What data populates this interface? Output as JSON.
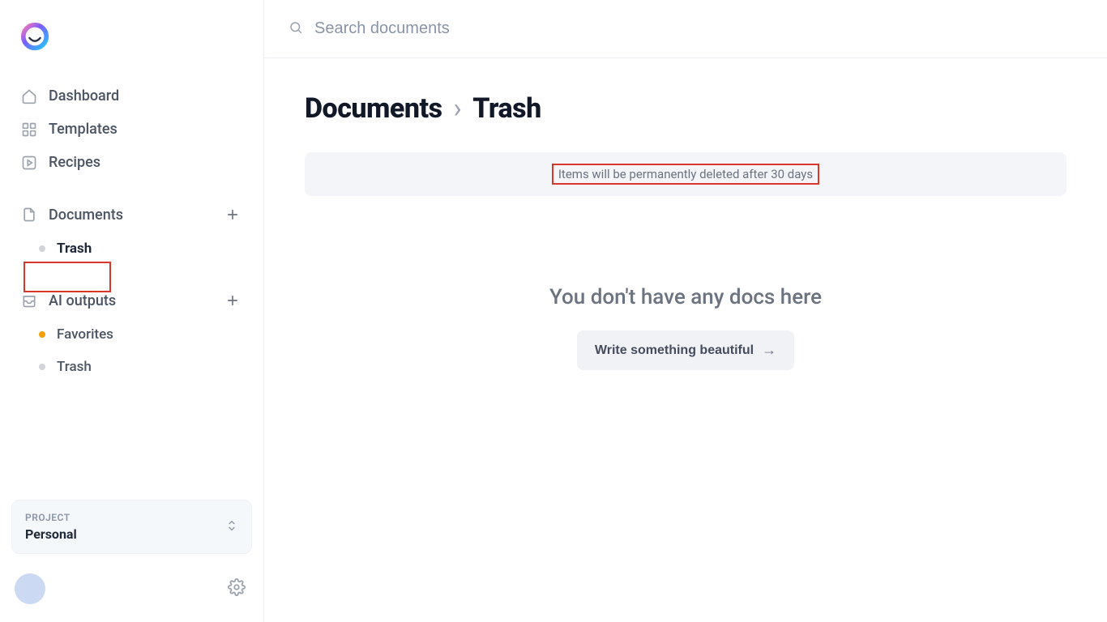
{
  "search": {
    "placeholder": "Search documents"
  },
  "sidebar": {
    "items": [
      {
        "label": "Dashboard"
      },
      {
        "label": "Templates"
      },
      {
        "label": "Recipes"
      },
      {
        "label": "Documents"
      },
      {
        "label": "Trash"
      },
      {
        "label": "AI outputs"
      },
      {
        "label": "Favorites"
      },
      {
        "label": "Trash"
      }
    ],
    "project": {
      "label": "PROJECT",
      "value": "Personal"
    }
  },
  "breadcrumb": {
    "root": "Documents",
    "current": "Trash"
  },
  "notice": "Items will be permanently deleted after 30 days",
  "empty": {
    "title": "You don't have any docs here",
    "cta": "Write something beautiful"
  }
}
